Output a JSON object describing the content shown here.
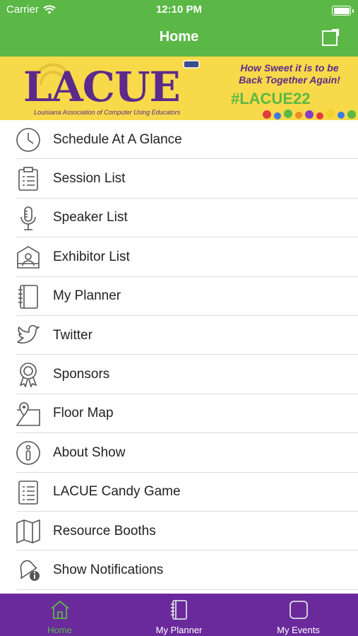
{
  "status": {
    "carrier": "Carrier",
    "time": "12:10 PM"
  },
  "header": {
    "title": "Home"
  },
  "banner": {
    "logo": "LACUE",
    "subtitle": "Louisiana Association of Computer Using Educators",
    "tagline_1": "How Sweet it is to be",
    "tagline_2": "Back Together Again!",
    "hashtag": "#LACUE22"
  },
  "menu": {
    "items": [
      {
        "label": "Schedule At A Glance",
        "icon": "clock-icon"
      },
      {
        "label": "Session List",
        "icon": "clipboard-icon"
      },
      {
        "label": "Speaker List",
        "icon": "microphone-icon"
      },
      {
        "label": "Exhibitor List",
        "icon": "booth-icon"
      },
      {
        "label": "My Planner",
        "icon": "notebook-icon"
      },
      {
        "label": "Twitter",
        "icon": "twitter-icon"
      },
      {
        "label": "Sponsors",
        "icon": "award-icon"
      },
      {
        "label": "Floor Map",
        "icon": "map-pin-icon"
      },
      {
        "label": "About Show",
        "icon": "info-icon"
      },
      {
        "label": "LACUE Candy Game",
        "icon": "list-icon"
      },
      {
        "label": "Resource Booths",
        "icon": "folded-map-icon"
      },
      {
        "label": "Show Notifications",
        "icon": "bell-icon"
      }
    ]
  },
  "tabbar": {
    "tabs": [
      {
        "label": "Home",
        "icon": "home-icon",
        "active": true
      },
      {
        "label": "My Planner",
        "icon": "notebook-icon",
        "active": false
      },
      {
        "label": "My Events",
        "icon": "square-icon",
        "active": false
      }
    ]
  },
  "colors": {
    "header_green": "#5bb846",
    "tabbar_purple": "#6a2a9c",
    "banner_yellow": "#f7d94a"
  }
}
